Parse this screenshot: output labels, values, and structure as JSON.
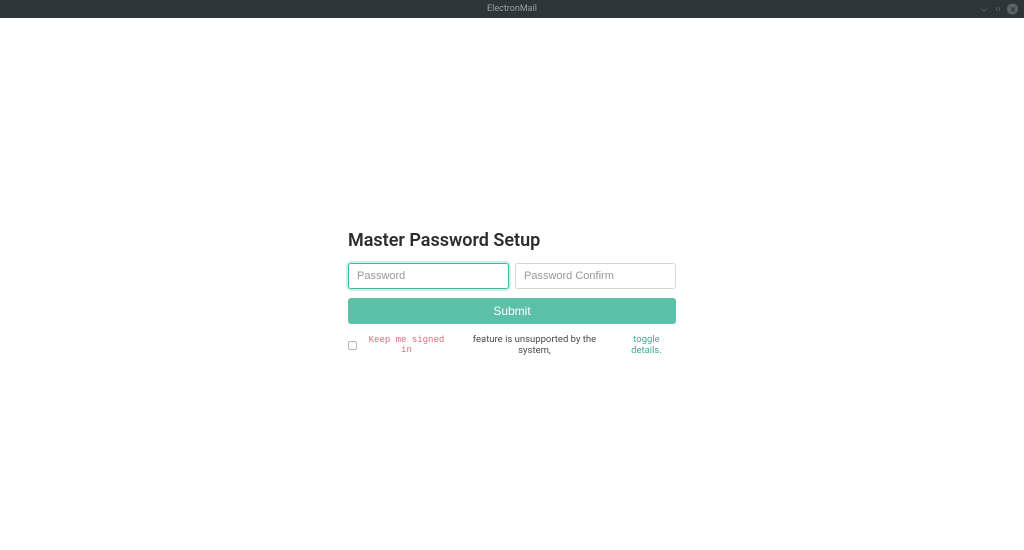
{
  "titlebar": {
    "app_name": "ElectronMail"
  },
  "form": {
    "heading": "Master Password Setup",
    "password_placeholder": "Password",
    "confirm_placeholder": "Password Confirm",
    "submit_label": "Submit"
  },
  "notice": {
    "feature_name": "Keep me signed in",
    "unsupported_text": "feature is unsupported by the system,",
    "toggle_link": "toggle details."
  }
}
